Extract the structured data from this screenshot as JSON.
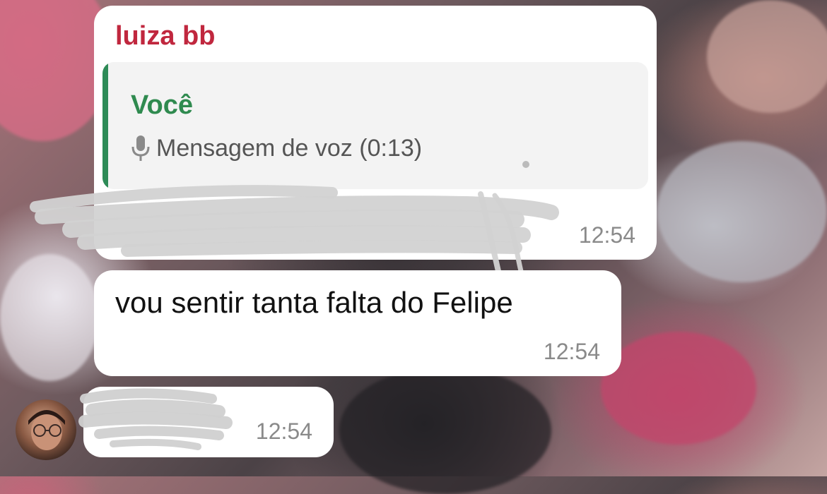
{
  "messages": [
    {
      "sender": "luiza bb",
      "quote": {
        "author": "Você",
        "text": "Mensagem de voz (0:13)",
        "icon": "microphone-icon"
      },
      "text": "",
      "time": "12:54"
    },
    {
      "text": "vou sentir tanta falta do Felipe",
      "time": "12:54"
    },
    {
      "text": "",
      "time": "12:54"
    }
  ],
  "colors": {
    "sender_name": "#c0273e",
    "quote_author": "#2f8a4f",
    "quote_bar": "#2e8b57",
    "timestamp": "#8a8a8a"
  }
}
